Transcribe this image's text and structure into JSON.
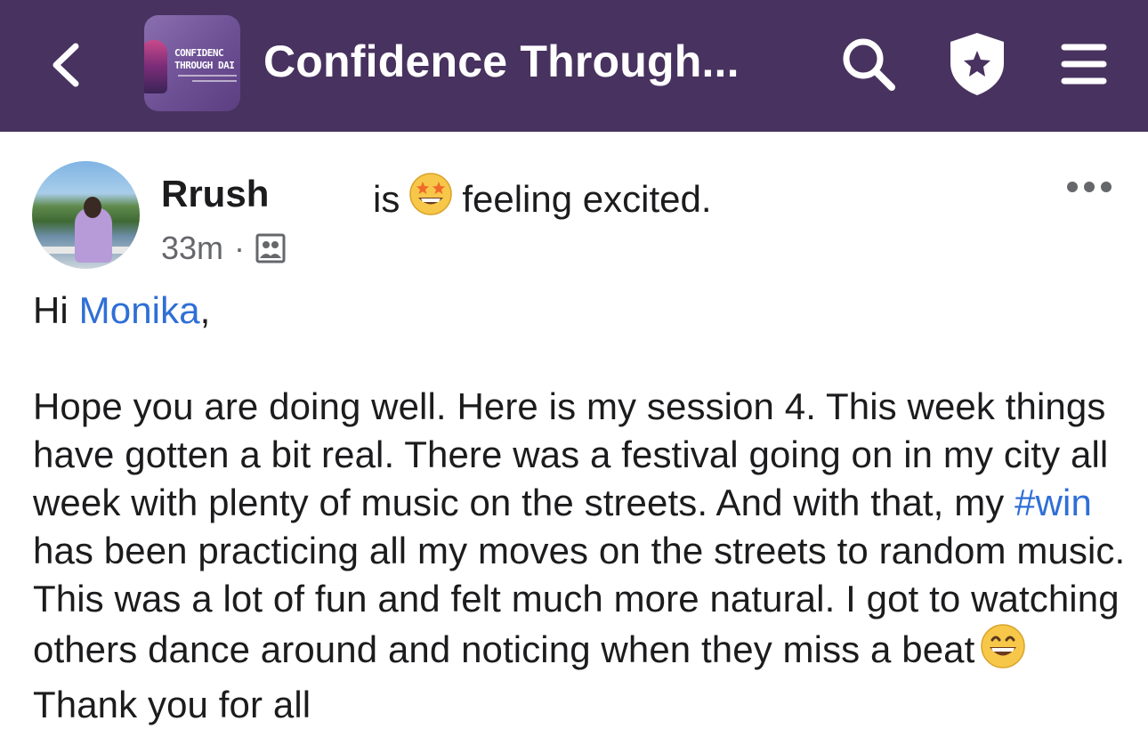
{
  "header": {
    "back_icon": "chevron-left-icon",
    "group_thumb_line1": "CONFIDENC",
    "group_thumb_line2": "THROUGH DAI",
    "group_title": "Confidence Through...",
    "search_icon": "search-icon",
    "shield_icon": "shield-star-icon",
    "menu_icon": "hamburger-menu-icon",
    "background_color": "#48325f"
  },
  "post": {
    "author": "Rrush",
    "feeling_prefix": "is",
    "feeling_emoji": "star-struck-emoji",
    "feeling_text": "feeling excited.",
    "time": "33m",
    "dot": "·",
    "audience_icon": "group-audience-icon",
    "more_icon": "more-dots-icon",
    "greeting_hi": "Hi",
    "mention": "Monika",
    "greeting_comma": ",",
    "body_part1": "Hope you are doing well. Here is my session 4. This week things have gotten a bit real. There was a festival going on in my city all week with plenty of music on the streets. And with that, my ",
    "hashtag": "#win",
    "body_part2": " has been practicing all my moves on the streets to random music. This was a lot of fun and felt much more natural. I got to watching others dance around and noticing when they miss a beat",
    "body_emoji": "grinning-face-emoji",
    "body_part3": "Thank you for all",
    "link_color": "#2f6fd6"
  }
}
